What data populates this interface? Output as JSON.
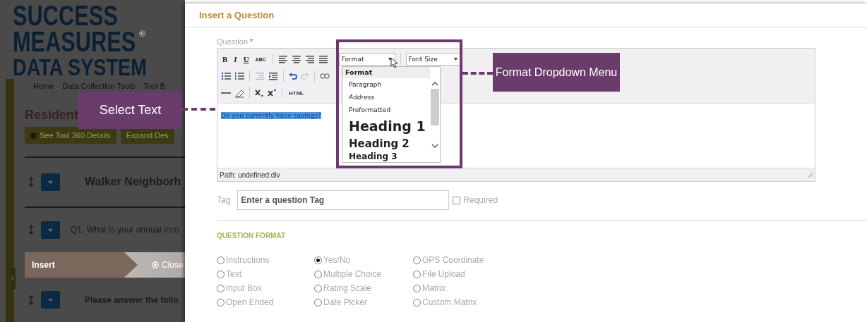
{
  "background_page": {
    "logo": {
      "line_1": "SUCCESS",
      "line_2": "MEASURES",
      "mark": "®",
      "line_3": "DATA SYSTEM"
    },
    "breadcrumb": [
      "Home",
      "Data Collection Tools",
      "Tool B"
    ],
    "page_title": "Resident",
    "buttons": [
      {
        "label": "See Tool 360 Details",
        "kind": "info"
      },
      {
        "label": "Expand Des",
        "kind": "plain"
      }
    ],
    "rows": [
      {
        "kind": "section",
        "text": "Walker Neighborh"
      },
      {
        "kind": "question",
        "text": "Q1. What is your annual inco"
      },
      {
        "kind": "insert_bar",
        "insert": "Insert",
        "close": "Close"
      },
      {
        "kind": "section_small",
        "text": "Please answer the follo"
      }
    ]
  },
  "dialog": {
    "title": "Insert a Question",
    "question_label": "Question",
    "required_mark": "*",
    "editor": {
      "toolbar_text": {
        "bold": "B",
        "italic": "I",
        "underline": "U",
        "strikethrough": "ABC",
        "html": "HTML"
      },
      "format_select": "Format",
      "font_size_select": "Font Size",
      "format_menu": {
        "expanded": true,
        "items": [
          {
            "kind": "header",
            "label": "Format"
          },
          {
            "kind": "paragraph",
            "label": "Paragraph"
          },
          {
            "kind": "address",
            "label": "Address"
          },
          {
            "kind": "preformatted",
            "label": "Preformatted"
          },
          {
            "kind": "heading1",
            "label": "Heading 1"
          },
          {
            "kind": "heading2",
            "label": "Heading 2"
          },
          {
            "kind": "heading3",
            "label": "Heading 3"
          }
        ]
      },
      "content": "Do you currently have savings?",
      "content_selected": true,
      "path": "Path: undefined:div"
    },
    "tag": {
      "label": "Tag",
      "placeholder": "Enter a question Tag"
    },
    "required_checkbox": {
      "label": "Required",
      "checked": false
    },
    "question_format": {
      "heading": "QUESTION FORMAT",
      "options": [
        {
          "label": "Instructions",
          "selected": false
        },
        {
          "label": "Yes/No",
          "selected": true
        },
        {
          "label": "GPS Coordinate",
          "selected": false
        },
        {
          "label": "Text",
          "selected": false
        },
        {
          "label": "Multiple Choice",
          "selected": false
        },
        {
          "label": "File Upload",
          "selected": false
        },
        {
          "label": "Input Box",
          "selected": false
        },
        {
          "label": "Rating Scale",
          "selected": false
        },
        {
          "label": "Matrix",
          "selected": false
        },
        {
          "label": "Open Ended",
          "selected": false
        },
        {
          "label": "Date Picker",
          "selected": false
        },
        {
          "label": "Custom Matrix",
          "selected": false
        }
      ]
    }
  },
  "callouts": [
    {
      "text": "Select Text"
    },
    {
      "text": "Format Dropdown Menu"
    }
  ]
}
